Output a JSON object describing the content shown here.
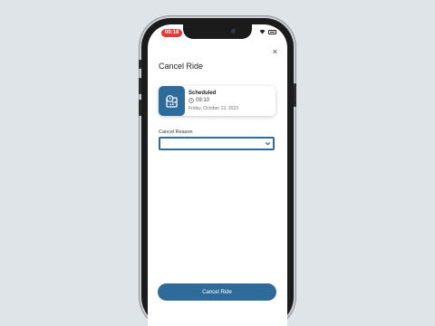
{
  "status_bar": {
    "time": "00:18"
  },
  "header": {
    "title": "Cancel Ride",
    "close_symbol": "×"
  },
  "ride_card": {
    "status": "Scheduled",
    "time": "09:10",
    "date": "Friday, October 13, 2023"
  },
  "form": {
    "reason_label": "Cancel Reason",
    "reason_value": ""
  },
  "footer": {
    "cancel_button_label": "Cancel Ride"
  },
  "colors": {
    "accent": "#2e6b9a",
    "status_time_bg": "#e53935"
  }
}
